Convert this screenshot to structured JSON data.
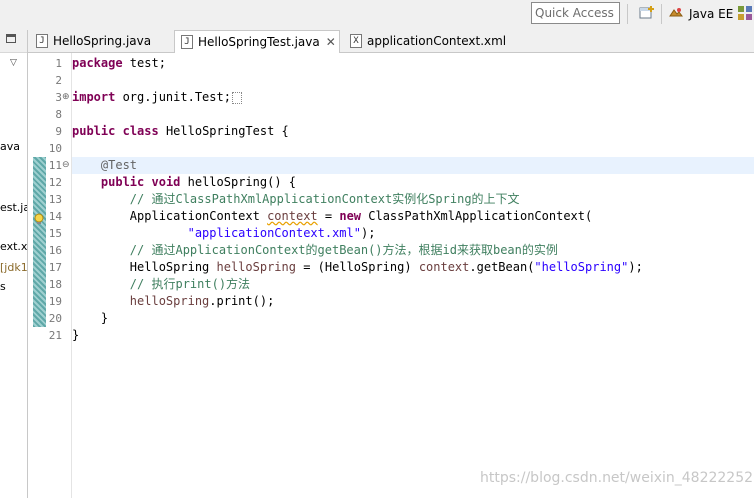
{
  "toolbar": {
    "quick_access_placeholder": "Quick Access",
    "perspective_label": "Java EE"
  },
  "left_panel": {
    "items": [
      "ava",
      "est.ja",
      "ext.xr",
      "[jdk1",
      "s"
    ]
  },
  "tabs": [
    {
      "label": "HelloSpring.java",
      "icon": "J",
      "active": false
    },
    {
      "label": "HelloSpringTest.java",
      "icon": "J",
      "active": true
    },
    {
      "label": "applicationContext.xml",
      "icon": "X",
      "active": false
    }
  ],
  "editor": {
    "line_numbers": [
      "1",
      "2",
      "3",
      "8",
      "9",
      "10",
      "11",
      "12",
      "13",
      "14",
      "15",
      "16",
      "17",
      "18",
      "19",
      "20",
      "21"
    ],
    "current_line": "11",
    "lines": {
      "l1_kw": "package",
      "l1_rest": " test;",
      "l3_kw": "import",
      "l3_rest": " org.junit.Test;",
      "l9_kw1": "public",
      "l9_kw2": "class",
      "l9_rest": " HelloSpringTest {",
      "l11_ann": "@Test",
      "l12_kw1": "public",
      "l12_kw2": "void",
      "l12_rest": " helloSpring() {",
      "l13_comment": "// 通过ClassPathXmlApplicationContext实例化Spring的上下文",
      "l14_type": "ApplicationContext ",
      "l14_var": "context",
      "l14_mid": " = ",
      "l14_new": "new",
      "l14_rest": " ClassPathXmlApplicationContext(",
      "l15_str": "\"applicationContext.xml\"",
      "l15_rest": ");",
      "l16_comment": "// 通过ApplicationContext的getBean()方法，根据id来获取bean的实例",
      "l17_type": "HelloSpring ",
      "l17_var": "helloSpring",
      "l17_mid": " = (HelloSpring) ",
      "l17_var2": "context",
      "l17_call": ".getBean(",
      "l17_str": "\"helloSpring\"",
      "l17_rest": ");",
      "l18_comment": "// 执行print()方法",
      "l19_var": "helloSpring",
      "l19_rest": ".print();",
      "l20": "}",
      "l21": "}"
    }
  },
  "watermark": "https://blog.csdn.net/weixin_48222252",
  "colors": {
    "keyword": "#7f0055",
    "comment": "#3f7f5f",
    "string": "#2a00ff",
    "annotation": "#646464",
    "current_line_bg": "#e8f2fe"
  }
}
